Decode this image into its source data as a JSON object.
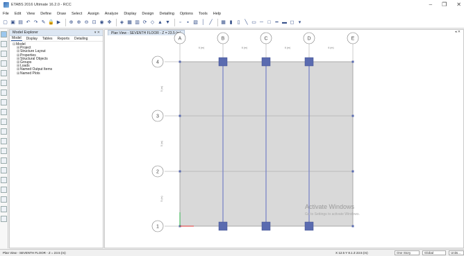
{
  "window": {
    "title": "ETABS 2016 Ultimate 16.2.0 - RCC",
    "minimize_glyph": "–",
    "restore_glyph": "❐",
    "close_glyph": "✕"
  },
  "menu": [
    "File",
    "Edit",
    "View",
    "Define",
    "Draw",
    "Select",
    "Assign",
    "Analyze",
    "Display",
    "Design",
    "Detailing",
    "Options",
    "Tools",
    "Help"
  ],
  "toolbar_icons": [
    "new-icon",
    "open-icon",
    "save-icon",
    "undo-icon",
    "redo-icon",
    "pencil-icon",
    "lock-icon",
    "run-icon",
    "zoom-window-icon",
    "zoom-in-icon",
    "zoom-out-icon",
    "zoom-fit-icon",
    "zoom-previous-icon",
    "pan-icon",
    "3d-view-icon",
    "plan-view-icon",
    "elevation-view-icon",
    "rotate-icon",
    "perspective-icon",
    "up-icon",
    "down-icon",
    "object-shrink-icon",
    "set-display-icon",
    "assign-icon",
    "frame-icon",
    "section-cut-icon",
    "grid-icon",
    "wall-icon",
    "column-icon",
    "brace-icon",
    "floor-icon",
    "line-icon",
    "area-icon",
    "beam-icon",
    "rectangle-icon",
    "slab-icon",
    "dropdown-icon"
  ],
  "explorer": {
    "title": "Model Explorer",
    "pin": "▾ ✕",
    "tabs": [
      "Model",
      "Display",
      "Tables",
      "Reports",
      "Detailing"
    ],
    "tree": [
      {
        "label": "Model",
        "level": 0,
        "toggle": "⊟"
      },
      {
        "label": "Project",
        "level": 1,
        "toggle": "⊞"
      },
      {
        "label": "Structure Layout",
        "level": 1,
        "toggle": "⊞"
      },
      {
        "label": "Properties",
        "level": 1,
        "toggle": "⊞"
      },
      {
        "label": "Structural Objects",
        "level": 1,
        "toggle": "⊞"
      },
      {
        "label": "Groups",
        "level": 1,
        "toggle": "⊞"
      },
      {
        "label": "Loads",
        "level": 1,
        "toggle": "⊞"
      },
      {
        "label": "Named Output Items",
        "level": 1,
        "toggle": "⊞"
      },
      {
        "label": "Named Plots",
        "level": 1,
        "toggle": "⊞"
      }
    ]
  },
  "plan_view": {
    "tab_title": "Plan View - SEVENTH FLOOR - Z = 23.5 (m)",
    "close_glyph": "◂ ✕",
    "grid_columns": [
      "A",
      "B",
      "C",
      "D",
      "E"
    ],
    "grid_rows": [
      "4",
      "3",
      "2",
      "1"
    ],
    "dimensions_x": [
      "6 (m)",
      "6 (m)",
      "6 (m)",
      "6 (m)"
    ],
    "dimensions_y": [
      "5 (m)",
      "5 (m)",
      "5 (m)"
    ],
    "colors": {
      "slab": "#d9d9d9",
      "beam": "#7b86c7",
      "column": "#5a6bb0",
      "grid": "#9a9a9a"
    }
  },
  "watermark": {
    "title": "Activate Windows",
    "subtitle": "Go to Settings to activate Windows."
  },
  "status": {
    "view": "Plan View - SEVENTH FLOOR - Z = 23.5 (m)",
    "coords": "X 12.5  Y 8.1  Z 23.5 (m)",
    "story": "One Story",
    "system": "Global",
    "units": "Units..."
  }
}
